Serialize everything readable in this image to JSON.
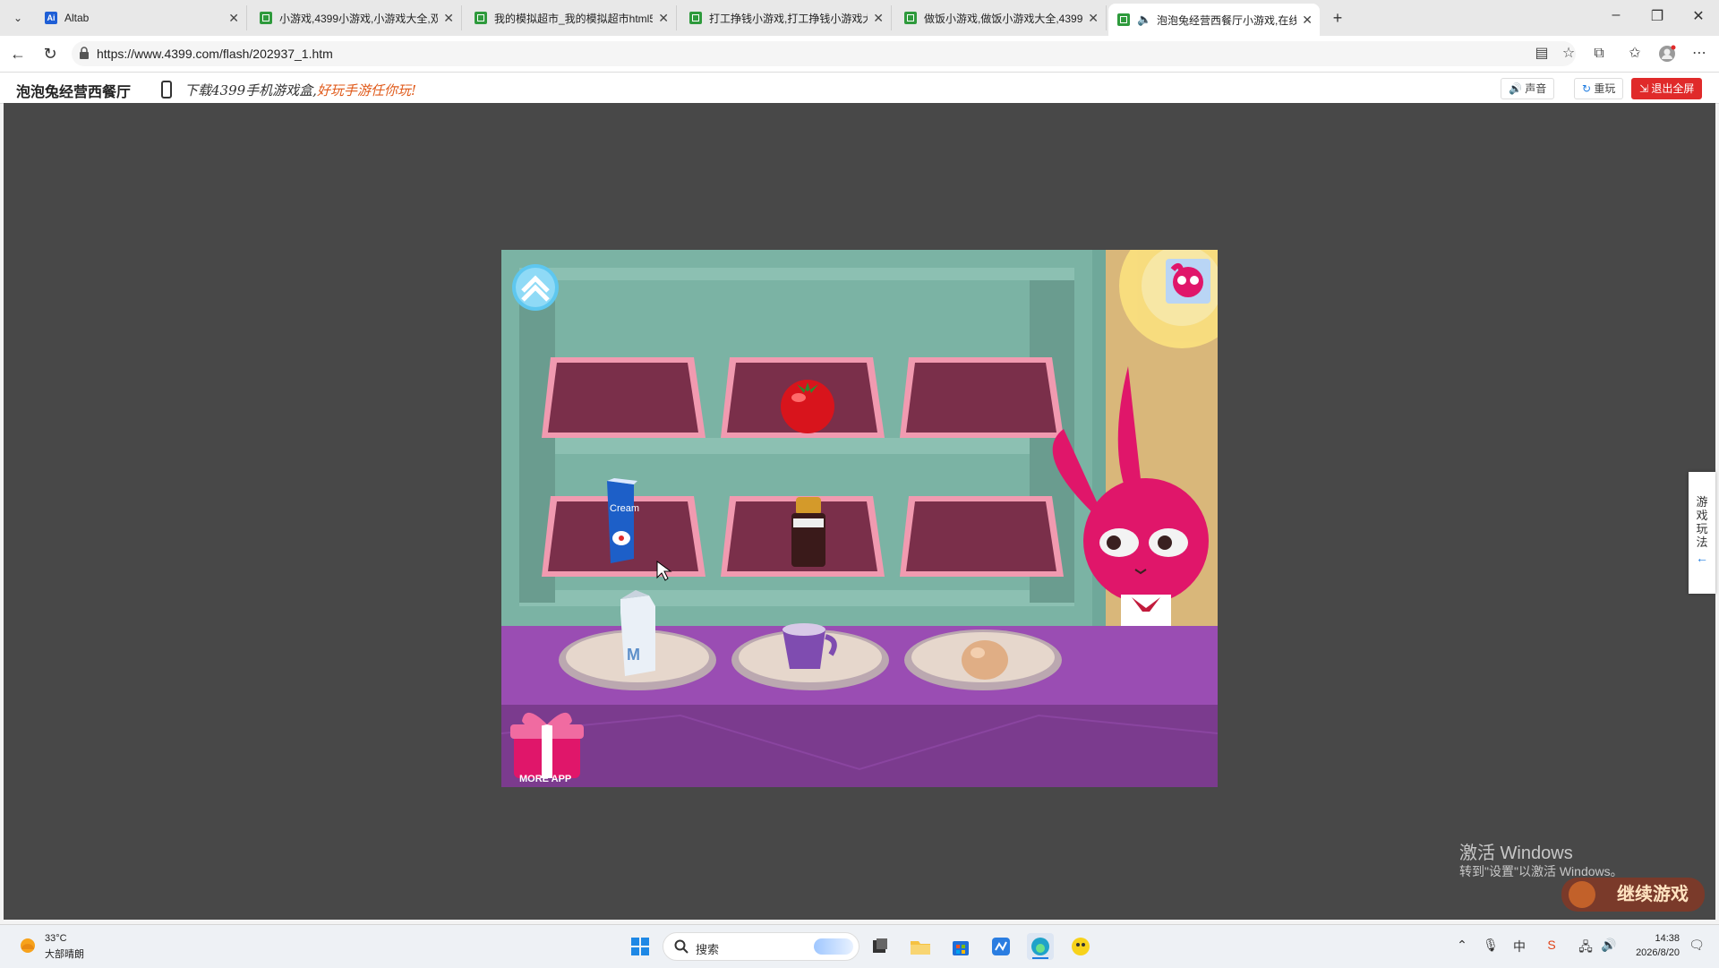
{
  "tabs": [
    {
      "label": "Altab",
      "icon": "ai-icon"
    },
    {
      "label": "小游戏,4399小游戏,小游戏大全,双",
      "icon": "site-icon"
    },
    {
      "label": "我的模拟超市_我的模拟超市html5",
      "icon": "site-icon"
    },
    {
      "label": "打工挣钱小游戏,打工挣钱小游戏大",
      "icon": "site-icon"
    },
    {
      "label": "做饭小游戏,做饭小游戏大全,4399",
      "icon": "site-icon"
    },
    {
      "label": "泡泡兔经营西餐厅小游戏,在线",
      "icon": "site-icon",
      "active": true
    }
  ],
  "address": {
    "url": "https://www.4399.com/flash/202937_1.htm"
  },
  "game_header": {
    "title": "泡泡兔经营西餐厅",
    "promo_a": "下载4399手机游戏盒,",
    "promo_b": "好玩手游任你玩!",
    "sound_label": "声音",
    "replay_label": "重玩",
    "exit_label": "退出全屏"
  },
  "game": {
    "cream_label": "Cream",
    "milk_label": "M",
    "more_app_label": "MORE APP",
    "items_on_shelves": [
      "tomato-icon",
      "cream-carton-icon",
      "sauce-bottle-icon"
    ],
    "items_on_plates": [
      "milk-carton-icon",
      "cup-icon",
      "egg-icon"
    ]
  },
  "side_help": {
    "label": "游戏玩法"
  },
  "watermark": {
    "line1": "激活 Windows",
    "line2": "转到\"设置\"以激活 Windows。"
  },
  "continue_button": {
    "label": "继续游戏"
  },
  "taskbar": {
    "weather_temp": "33°C",
    "weather_desc": "大部晴朗",
    "search_label": "搜索",
    "time": "14:38",
    "date": "2026/8/20"
  },
  "colors": {
    "stage_bg": "#484848",
    "shelf_bg": "#6fa89a",
    "tray": "#7a2f4a",
    "counter": "#8a3d9a",
    "exit_btn": "#e02a2a"
  }
}
